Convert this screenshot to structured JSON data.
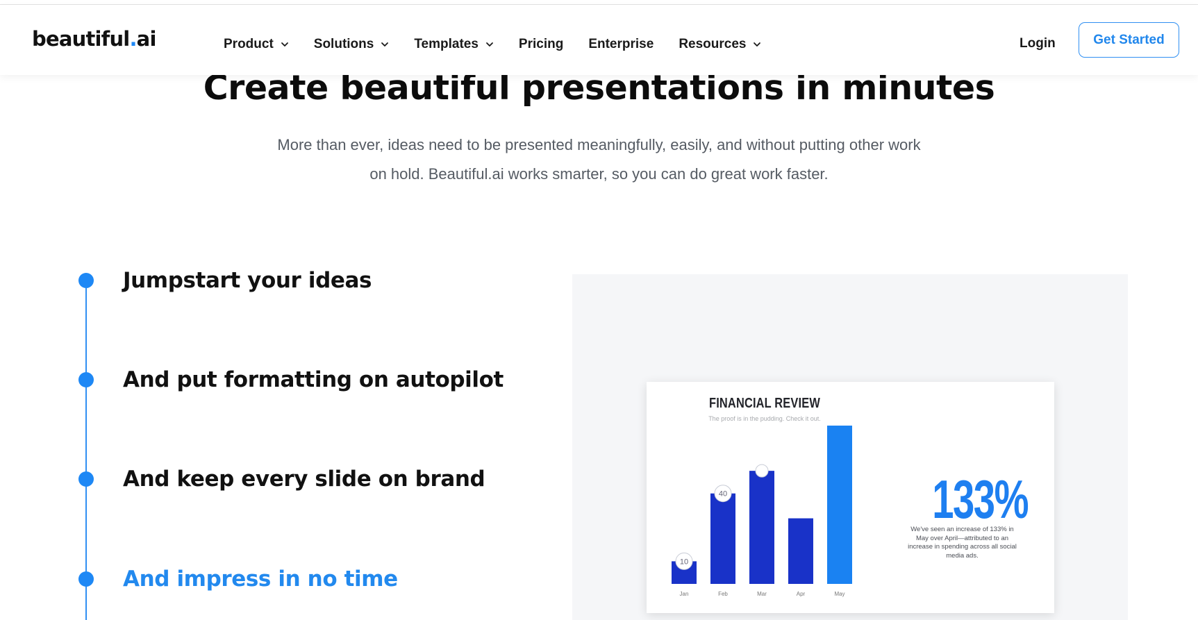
{
  "header": {
    "logo": {
      "text": "beautiful",
      "dot": ".",
      "suffix": "ai"
    },
    "nav": [
      {
        "label": "Product",
        "dropdown": true
      },
      {
        "label": "Solutions",
        "dropdown": true
      },
      {
        "label": "Templates",
        "dropdown": true
      },
      {
        "label": "Pricing",
        "dropdown": false
      },
      {
        "label": "Enterprise",
        "dropdown": false
      },
      {
        "label": "Resources",
        "dropdown": true
      }
    ],
    "login": "Login",
    "cta": "Get Started"
  },
  "hero": {
    "title": "Create beautiful presentations in minutes",
    "subtitle_line1": "More than ever, ideas need to be presented meaningfully, easily, and without putting other work",
    "subtitle_line2": "on hold. Beautiful.ai works smarter, so you can do great work faster."
  },
  "timeline": [
    {
      "label": "Jumpstart your ideas",
      "active": false
    },
    {
      "label": "And put formatting on autopilot",
      "active": false
    },
    {
      "label": "And keep every slide on brand",
      "active": false
    },
    {
      "label": "And impress in no time",
      "active": true
    }
  ],
  "slide": {
    "title": "FINANCIAL REVIEW",
    "subtitle": "The proof is in the pudding. Check it out.",
    "stat": "133%",
    "stat_description": "We've seen an increase of 133% in May over April—attributed to an increase in spending across all social media ads."
  },
  "chart_data": {
    "type": "bar",
    "categories": [
      "Jan",
      "Feb",
      "Mar",
      "Apr",
      "May"
    ],
    "values": [
      10,
      40,
      50,
      29,
      70
    ],
    "value_labels": [
      "10",
      "40",
      "",
      "",
      ""
    ],
    "colors": [
      "#1932c8",
      "#1932c8",
      "#1932c8",
      "#1932c8",
      "#1a82f2"
    ],
    "ylim": [
      0,
      70
    ]
  },
  "colors": {
    "accent": "#1e88f5",
    "bar_dark": "#1932c8",
    "bar_highlight": "#1a82f2"
  }
}
